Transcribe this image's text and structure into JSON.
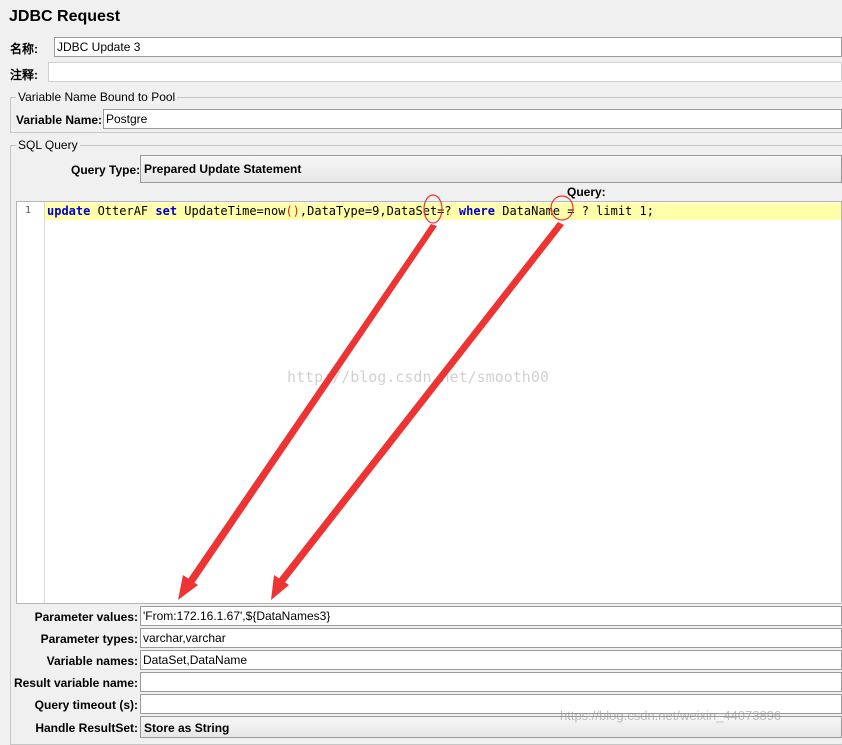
{
  "title": "JDBC Request",
  "name_label": "名称:",
  "name_value": "JDBC Update 3",
  "comment_label": "注释:",
  "comment_value": "",
  "var_pool": {
    "legend": "Variable Name Bound to Pool",
    "label": "Variable Name:",
    "value": "Postgre"
  },
  "sql_query": {
    "legend": "SQL Query",
    "query_type_label": "Query Type:",
    "query_type_value": "Prepared Update Statement",
    "query_label": "Query:",
    "line_number": "1",
    "code": {
      "kw_update": "update",
      "t1": " OtterAF ",
      "kw_set": "set",
      "t2": " UpdateTime=now",
      "paren": "()",
      "t3": ",DataType=9,DataSet=",
      "q1": "?",
      "t4": " ",
      "kw_where": "where",
      "t5": " DataName = ",
      "q2": "?",
      "t6": " limit 1;"
    }
  },
  "watermark": "http://blog.csdn.net/smooth00",
  "watermark_bottom": "https://blog.csdn.net/weixin_44073896",
  "params": {
    "values_label": "Parameter values:",
    "values_value": "'From:172.16.1.67',${DataNames3}",
    "types_label": "Parameter types:",
    "types_value": "varchar,varchar",
    "varnames_label": "Variable names:",
    "varnames_value": "DataSet,DataName",
    "result_label": "Result variable name:",
    "result_value": "",
    "timeout_label": "Query timeout (s):",
    "timeout_value": "",
    "handle_label": "Handle ResultSet:",
    "handle_value": "Store as String"
  },
  "colors": {
    "annotation_red": "#ee3333",
    "code_highlight": "#ffffaa",
    "keyword_blue": "#0000c8"
  }
}
